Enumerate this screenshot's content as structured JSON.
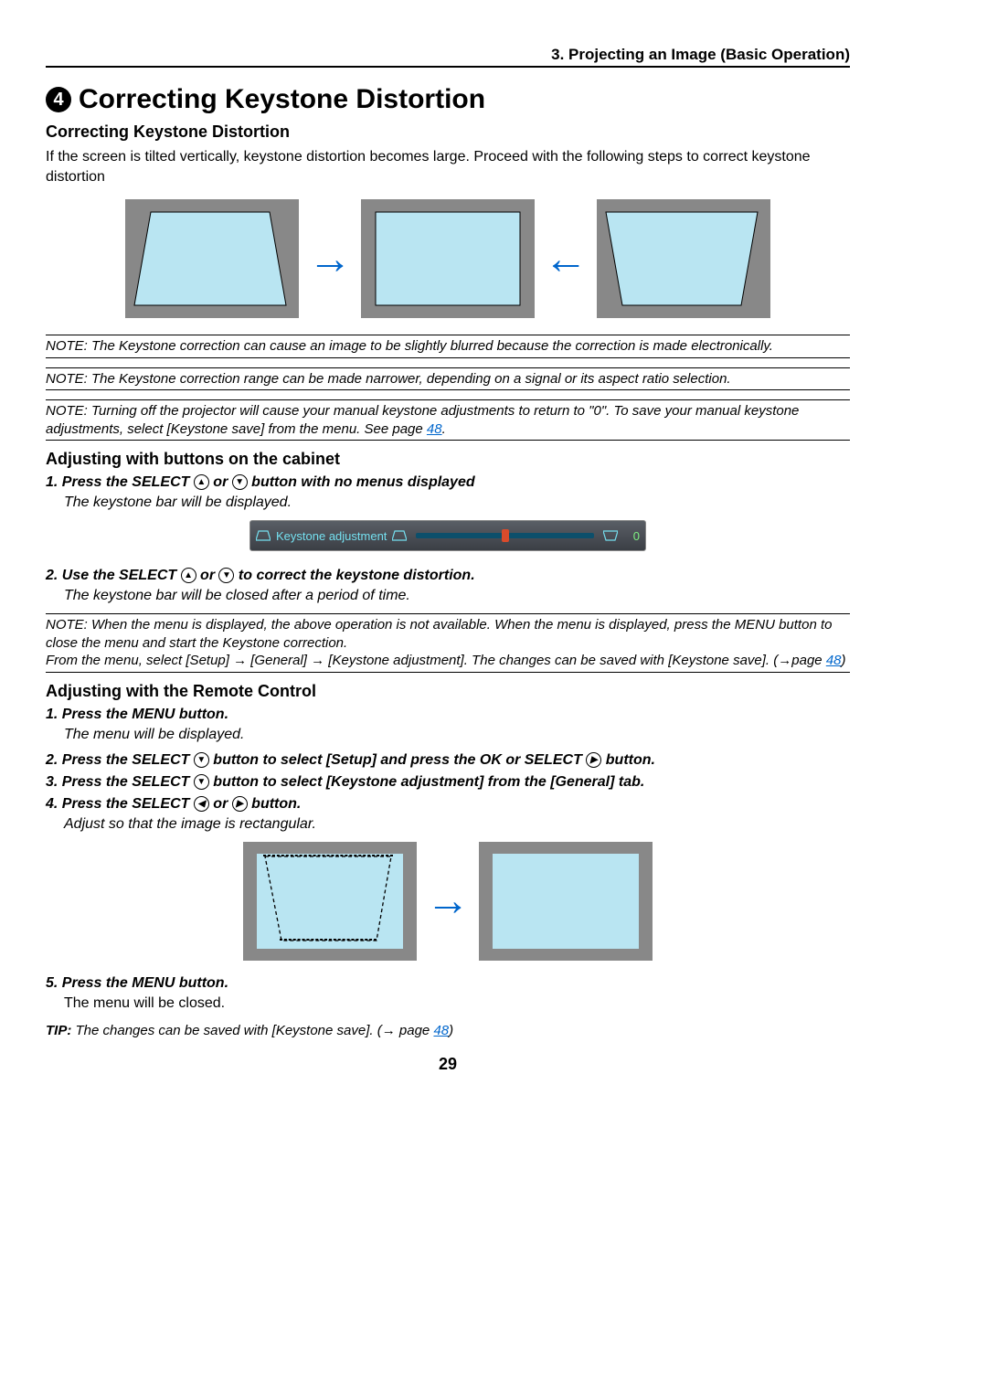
{
  "header": {
    "breadcrumb": "3. Projecting an Image (Basic Operation)"
  },
  "section": {
    "number": "4",
    "title": "Correcting Keystone Distortion",
    "subtitle": "Correcting Keystone Distortion",
    "intro": "If the screen is tilted vertically, keystone distortion becomes large. Proceed with the following steps to correct keystone distortion"
  },
  "notes": {
    "n1": "NOTE: The Keystone correction can cause an image to be slightly blurred because the correction is made electronically.",
    "n2": "NOTE: The Keystone correction range can be made narrower, depending on a signal or its aspect ratio selection.",
    "n3_a": "NOTE: Turning off the projector will cause your manual keystone adjustments to return to \"0\". To save your manual keystone adjustments, select [Keystone save] from the menu. See page ",
    "n3_link": "48",
    "n3_b": ".",
    "n4_a": "NOTE: When the menu is displayed, the above operation is not available. When the menu is displayed, press the MENU button to close the menu and start the Keystone correction.",
    "n4_b_pre": "From the menu, select [Setup] ",
    "n4_b_mid1": " [General] ",
    "n4_b_mid2": " [Keystone adjustment]. The changes can be saved with [Keystone save]. (",
    "n4_b_post": "page ",
    "n4_link": "48",
    "n4_end": ")"
  },
  "cabinet": {
    "title": "Adjusting with buttons on the cabinet",
    "step1_pre": "1.  Press the SELECT ",
    "step1_mid": " or ",
    "step1_post": " button with no menus displayed",
    "step1_text": "The keystone bar will be displayed.",
    "step2_pre": "2.  Use the SELECT ",
    "step2_mid": " or ",
    "step2_post": " to correct the keystone distortion.",
    "step2_text": "The keystone bar will be closed after a period of time."
  },
  "osd": {
    "label": "Keystone adjustment",
    "value": "0"
  },
  "remote": {
    "title": "Adjusting with the Remote Control",
    "step1": "1.  Press the MENU button.",
    "step1_text": "The menu will be displayed.",
    "step2_pre": "2.  Press the SELECT ",
    "step2_mid": " button to select [Setup] and press the OK or SELECT ",
    "step2_post": " button.",
    "step3_pre": "3.  Press the SELECT ",
    "step3_post": " button to select [Keystone adjustment] from the [General] tab.",
    "step4_pre": "4.  Press the SELECT ",
    "step4_mid": " or ",
    "step4_post": " button.",
    "step4_text": "Adjust so that the image is rectangular.",
    "step5": "5.  Press the MENU button.",
    "step5_text": "The menu will be closed."
  },
  "tip": {
    "label": "TIP:",
    "text_pre": " The changes can be saved with [Keystone save]. (",
    "text_post": " page ",
    "link": "48",
    "end": ")"
  },
  "page_number": "29",
  "icons": {
    "up": "▲",
    "down": "▼",
    "left": "◀",
    "right": "▶",
    "arrow_sym": "→"
  }
}
